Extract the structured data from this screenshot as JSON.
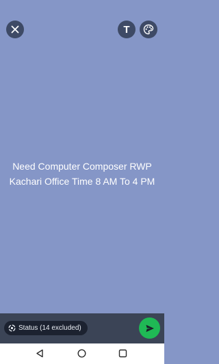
{
  "colors": {
    "canvas_background": "#8596c7",
    "control_background": "#3e4a66",
    "bottom_bar": "#3b4456",
    "send_button": "#1fb955"
  },
  "toolbar": {
    "close_icon": "close-icon",
    "text_tool_label": "T",
    "palette_icon": "palette-icon"
  },
  "status": {
    "text": "Need Computer Composer RWP Kachari Office Time 8 AM To 4 PM"
  },
  "footer": {
    "audience_label": "Status (14 excluded)",
    "audience_icon": "status-ring-icon",
    "send_icon": "send-arrow-icon"
  },
  "system_nav": {
    "back_icon": "back-triangle-icon",
    "home_icon": "home-circle-icon",
    "recent_icon": "recent-square-icon"
  }
}
